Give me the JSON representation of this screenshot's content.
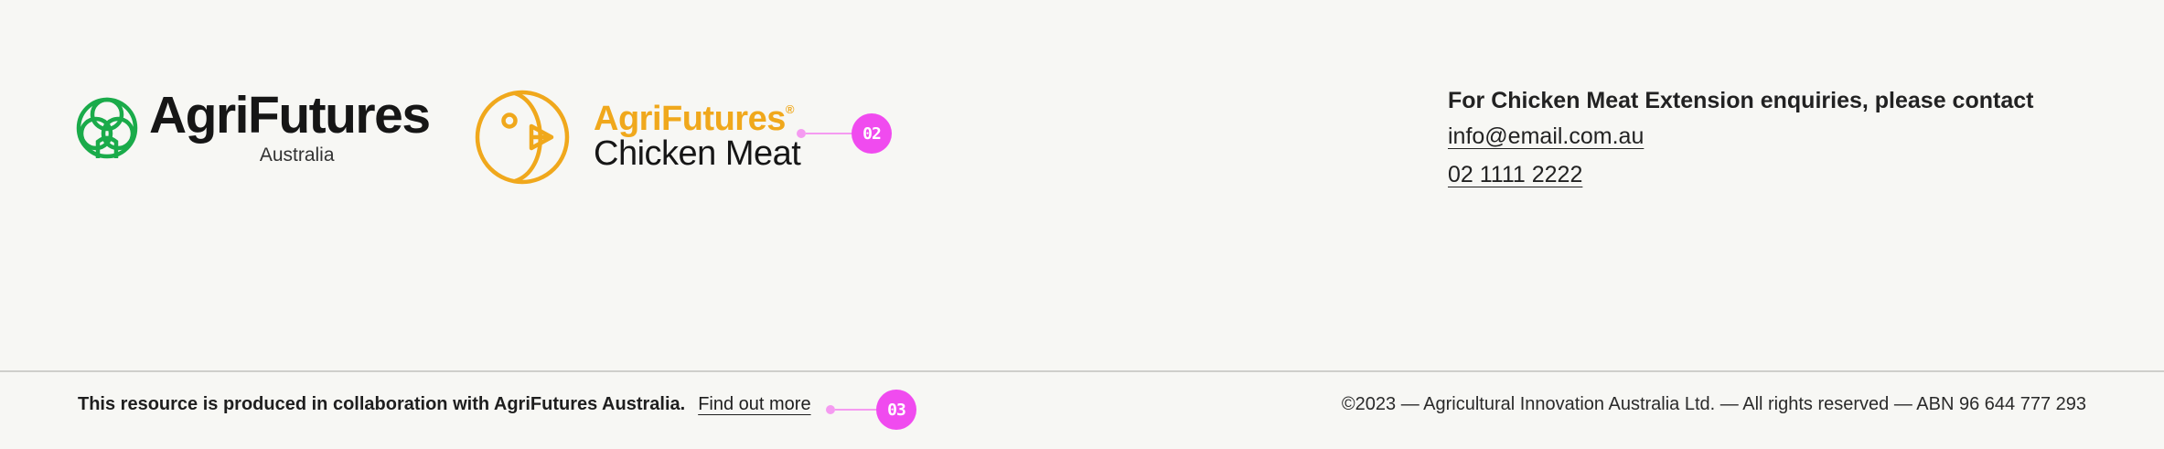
{
  "logos": {
    "agrifutures": {
      "wordmark": "AgriFutures",
      "subtitle": "Australia",
      "brand_color": "#1aab4a"
    },
    "chicken_meat": {
      "wordmark_top": "AgriFutures",
      "registered": "®",
      "wordmark_bottom": "Chicken Meat",
      "brand_color": "#f0a81c"
    }
  },
  "markers": {
    "logo_marker": "02",
    "footer_marker": "03",
    "color": "#f04bef"
  },
  "contact": {
    "heading": "For Chicken Meat Extension enquiries, please contact",
    "email": "info@email.com.au",
    "phone": "02 1111 2222"
  },
  "footer": {
    "credit": "This resource is produced in collaboration with AgriFutures Australia.",
    "link": "Find out more",
    "copyright": "©2023 — Agricultural Innovation Australia Ltd. — All rights reserved — ABN 96 644 777 293"
  }
}
